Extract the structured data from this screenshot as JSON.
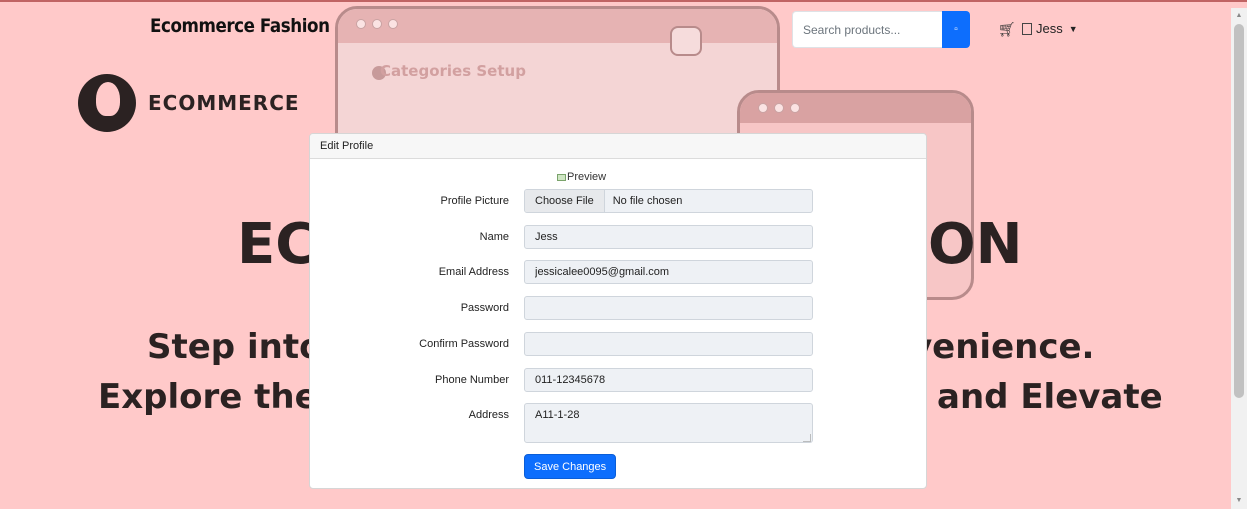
{
  "navbar": {
    "brand": "Ecommerce Fashion",
    "search_placeholder": "Search products...",
    "search_button": "▫",
    "cart_icon": "cart-icon",
    "user_name": "Jess",
    "caret": "▼"
  },
  "hero": {
    "logo_text": "ECOMMERCE",
    "window_caption": "Categories Setup",
    "big_left": "EC",
    "big_right": "ON",
    "line1_left": "Step into",
    "line1_right": "venience.",
    "line2_left": "Explore the",
    "line2_right": "and Elevate"
  },
  "modal": {
    "title": "Edit Profile",
    "preview_alt": "Preview",
    "fields": {
      "profile_picture": {
        "label": "Profile Picture",
        "button": "Choose File",
        "status": "No file chosen"
      },
      "name": {
        "label": "Name",
        "value": "Jess"
      },
      "email": {
        "label": "Email Address",
        "value": "jessicalee0095@gmail.com"
      },
      "password": {
        "label": "Password",
        "value": ""
      },
      "confirm_password": {
        "label": "Confirm Password",
        "value": ""
      },
      "phone": {
        "label": "Phone Number",
        "value": "011-12345678"
      },
      "address": {
        "label": "Address",
        "value": "A11-1-28"
      }
    },
    "save_label": "Save Changes"
  },
  "colors": {
    "page_bg": "#ffc9c9",
    "primary": "#0d6efd",
    "input_bg": "#eef1f5"
  }
}
